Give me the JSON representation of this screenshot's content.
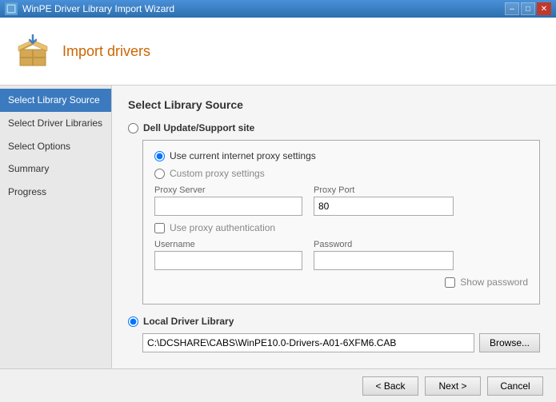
{
  "titleBar": {
    "title": "WinPE Driver Library Import Wizard",
    "minBtn": "–",
    "maxBtn": "□",
    "closeBtn": "✕"
  },
  "header": {
    "title": "Import drivers"
  },
  "sidebar": {
    "items": [
      {
        "id": "select-library-source",
        "label": "Select Library Source",
        "active": true
      },
      {
        "id": "select-driver-libraries",
        "label": "Select Driver Libraries",
        "active": false
      },
      {
        "id": "select-options",
        "label": "Select Options",
        "active": false
      },
      {
        "id": "summary",
        "label": "Summary",
        "active": false
      },
      {
        "id": "progress",
        "label": "Progress",
        "active": false
      }
    ]
  },
  "main": {
    "sectionTitle": "Select Library Source",
    "dellOption": {
      "label": "Dell Update/Support site",
      "radioName": "source",
      "value": "dell"
    },
    "proxyPanel": {
      "currentProxy": {
        "label": "Use current internet proxy settings",
        "value": "current"
      },
      "customProxy": {
        "label": "Custom proxy settings",
        "value": "custom"
      },
      "proxyServer": {
        "label": "Proxy Server",
        "value": ""
      },
      "proxyPort": {
        "label": "Proxy Port",
        "value": "80"
      },
      "proxyAuth": {
        "label": "Use proxy authentication"
      },
      "username": {
        "label": "Username",
        "value": ""
      },
      "password": {
        "label": "Password",
        "value": ""
      },
      "showPassword": {
        "label": "Show password"
      }
    },
    "localLibrary": {
      "label": "Local Driver Library",
      "radioName": "source",
      "value": "local",
      "path": "C:\\DCSHARE\\CABS\\WinPE10.0-Drivers-A01-6XFM6.CAB",
      "browseLabel": "Browse..."
    }
  },
  "bottomBar": {
    "backLabel": "< Back",
    "nextLabel": "Next >",
    "cancelLabel": "Cancel"
  }
}
